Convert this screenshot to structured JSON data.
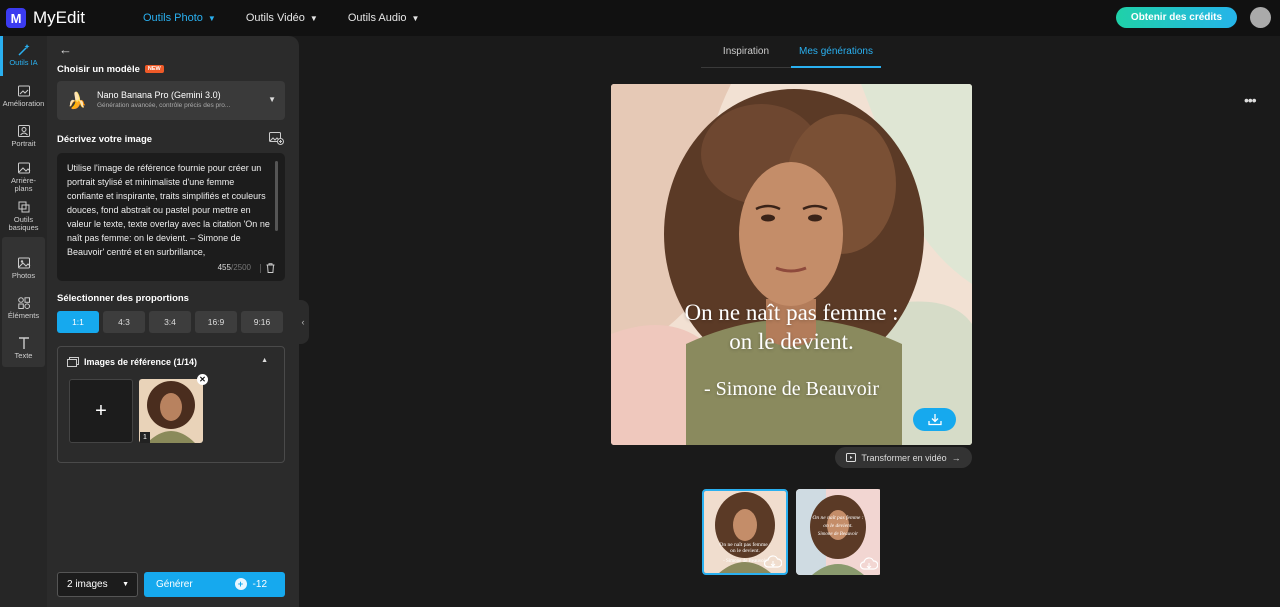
{
  "brand": {
    "name": "MyEdit",
    "mark": "M"
  },
  "topnav": [
    {
      "label": "Outils Photo",
      "active": true
    },
    {
      "label": "Outils Vidéo",
      "active": false
    },
    {
      "label": "Outils Audio",
      "active": false
    }
  ],
  "credits_button": "Obtenir des crédits",
  "rail": [
    {
      "label": "Outils IA",
      "icon": "magic-wand-icon",
      "active": true
    },
    {
      "label": "Amélioration",
      "icon": "enhance-icon"
    },
    {
      "label": "Portrait",
      "icon": "portrait-icon"
    },
    {
      "label": "Arrière-plans",
      "icon": "background-icon"
    },
    {
      "label": "Outils basiques",
      "icon": "crop-icon"
    },
    {
      "label": "Photos",
      "icon": "image-icon"
    },
    {
      "label": "Éléments",
      "icon": "shapes-icon"
    },
    {
      "label": "Texte",
      "icon": "text-icon"
    }
  ],
  "panel": {
    "model_title": "Choisir un modèle",
    "new_badge": "NEW",
    "model_name": "Nano Banana Pro (Gemini 3.0)",
    "model_desc": "Génération avancée, contrôle précis des pro...",
    "model_emoji": "🍌",
    "describe_title": "Décrivez votre image",
    "prompt": "Utilise l'image de référence fournie pour créer un portrait stylisé et minimaliste d'une femme confiante et inspirante, traits simplifiés et couleurs douces, fond abstrait ou pastel pour mettre en valeur le texte, texte overlay avec la citation 'On ne naît pas femme: on le devient. – Simone de Beauvoir' centré et en surbrillance,",
    "char_count": "455",
    "char_max": "/2500",
    "ratio_title": "Sélectionner des proportions",
    "ratios": [
      "1:1",
      "4:3",
      "3:4",
      "16:9",
      "9:16"
    ],
    "ratio_selected": "1:1",
    "ref_title": "Images de référence (1/14)",
    "ref_add": "+",
    "ref_thumb_index": "1",
    "count_label": "2 images",
    "generate_label": "Générer",
    "generate_cost": "-12"
  },
  "tabs": [
    {
      "label": "Inspiration",
      "active": false
    },
    {
      "label": "Mes générations",
      "active": true
    }
  ],
  "quote": {
    "line1": "On ne naît pas femme :",
    "line2": "on le devient.",
    "author": "- Simone de Beauvoir"
  },
  "thumbnail_2_quote": {
    "line1": "On ne naît pas femme :",
    "line2": "on le devient.",
    "author": "Simone de Beauvoir"
  },
  "transform_label": "Transformer en vidéo",
  "colors": {
    "accent": "#16a9ee",
    "brand": "#3b3bf0"
  }
}
